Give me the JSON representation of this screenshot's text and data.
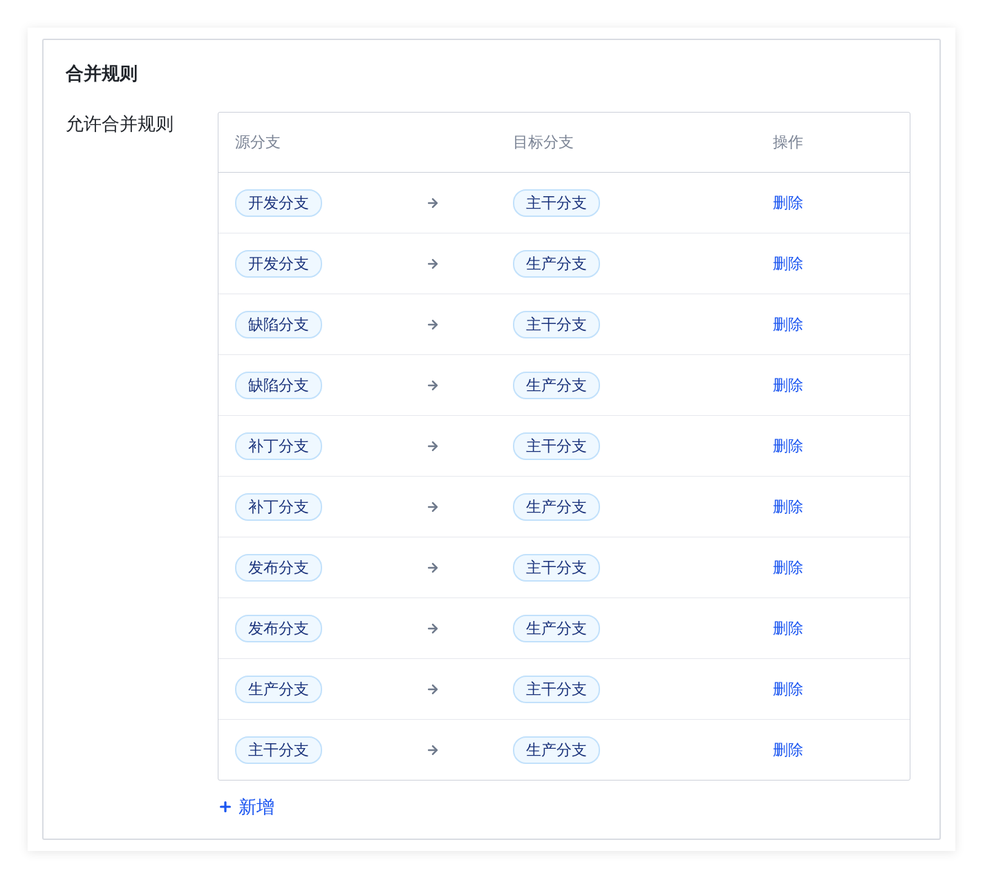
{
  "section": {
    "title": "合并规则",
    "field_label": "允许合并规则"
  },
  "table": {
    "columns": [
      {
        "label": "源分支"
      },
      {
        "label": "目标分支"
      },
      {
        "label": "操作"
      }
    ],
    "rows": [
      {
        "source": "开发分支",
        "target": "主干分支",
        "action": "删除"
      },
      {
        "source": "开发分支",
        "target": "生产分支",
        "action": "删除"
      },
      {
        "source": "缺陷分支",
        "target": "主干分支",
        "action": "删除"
      },
      {
        "source": "缺陷分支",
        "target": "生产分支",
        "action": "删除"
      },
      {
        "source": "补丁分支",
        "target": "主干分支",
        "action": "删除"
      },
      {
        "source": "补丁分支",
        "target": "生产分支",
        "action": "删除"
      },
      {
        "source": "发布分支",
        "target": "主干分支",
        "action": "删除"
      },
      {
        "source": "发布分支",
        "target": "生产分支",
        "action": "删除"
      },
      {
        "source": "生产分支",
        "target": "主干分支",
        "action": "删除"
      },
      {
        "source": "主干分支",
        "target": "生产分支",
        "action": "删除"
      }
    ]
  },
  "add_button": {
    "label": "新增"
  }
}
